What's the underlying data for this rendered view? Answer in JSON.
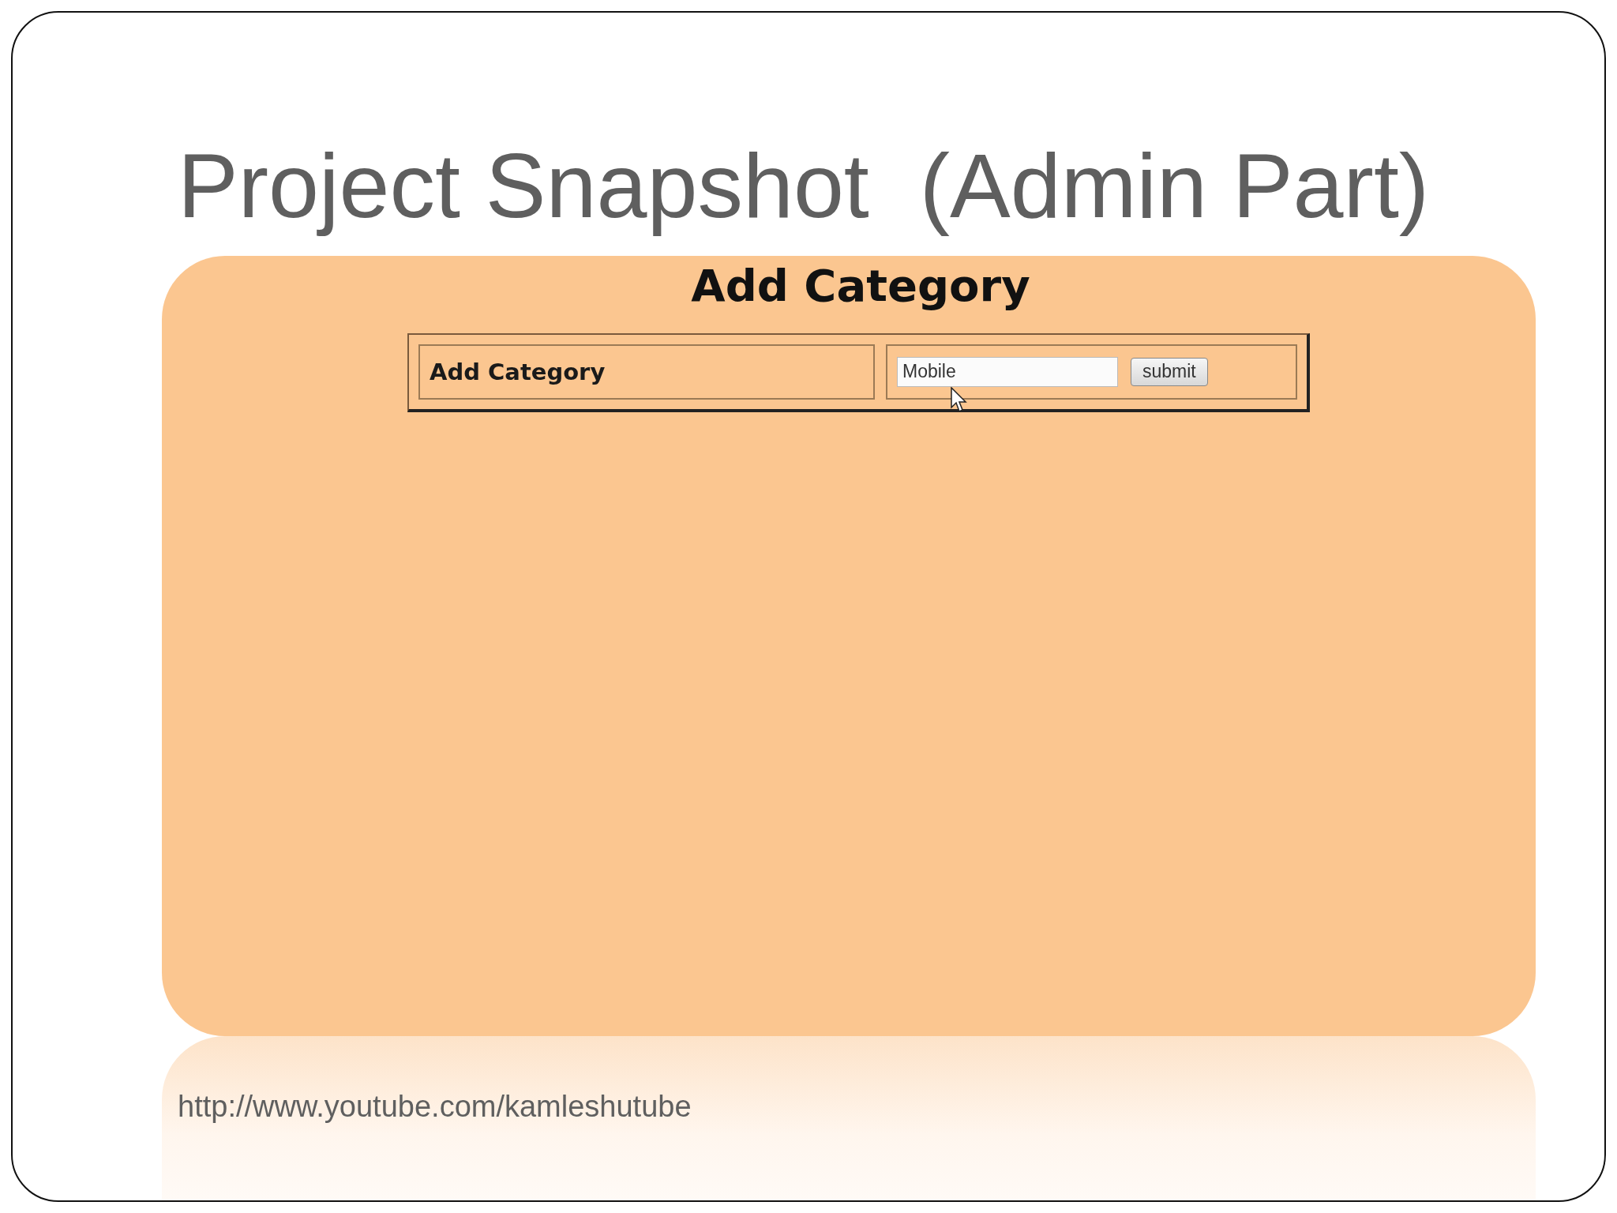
{
  "slide": {
    "title": "Project Snapshot  (Admin Part)",
    "footer_url": "http://www.youtube.com/kamleshutube"
  },
  "form": {
    "heading": "Add Category",
    "label": "Add Category",
    "input": {
      "value": "Mobile"
    },
    "button": "submit"
  }
}
